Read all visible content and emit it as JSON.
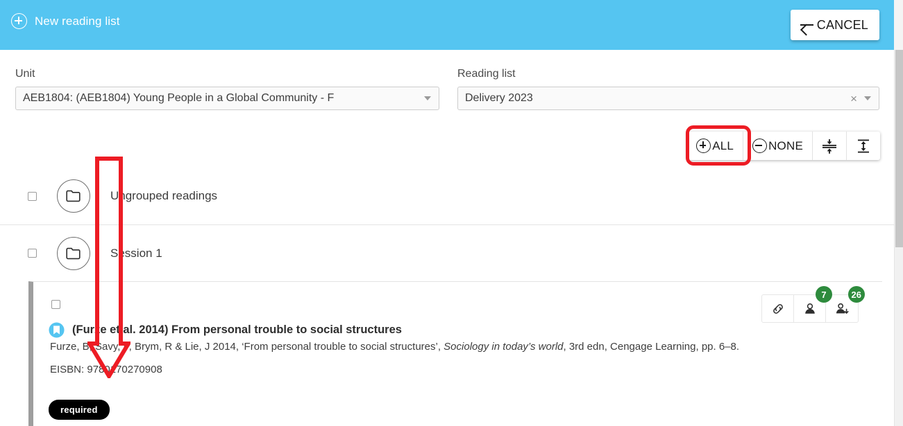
{
  "header": {
    "title": "New reading list",
    "add_icon": "plus-circle-icon",
    "cancel_label": "CANCEL",
    "back_icon": "arrow-left-icon",
    "background_color": "#55c5f1"
  },
  "form": {
    "unit": {
      "label": "Unit",
      "value": "AEB1804: (AEB1804) Young People in a Global Community - F",
      "caret_icon": "caret-down-icon"
    },
    "reading_list": {
      "label": "Reading list",
      "value": "Delivery 2023",
      "clear_icon": "×",
      "caret_icon": "caret-down-icon"
    }
  },
  "toolbar": {
    "all_label": "ALL",
    "none_label": "NONE",
    "all_icon": "plus-circle-icon",
    "none_icon": "minus-circle-icon",
    "collapse_icon": "collapse-all-icon",
    "expand_icon": "expand-all-icon"
  },
  "annotations": {
    "highlight_color": "#ed1c24",
    "rect_target": "ALL",
    "arrow_target": "reading-tree"
  },
  "folders": [
    {
      "name": "Ungrouped readings",
      "icon": "folder-icon",
      "checked": false
    },
    {
      "name": "Session 1",
      "icon": "folder-icon",
      "checked": false
    }
  ],
  "citation": {
    "checked": false,
    "type_icon": "book-icon",
    "title": "(Furze et al. 2014) From personal trouble to social structures",
    "reference_prefix": "Furze, B, Savy, P, Brym, R & Lie, J 2014, ‘From personal trouble to social structures’, ",
    "reference_italic": "Sociology in today’s world",
    "reference_suffix": ", 3rd edn, Cengage Learning, pp. 6–8.",
    "eisbn": "EISBN: 9780170270908",
    "required_badge": "required",
    "actions": [
      {
        "name": "link-icon",
        "badge": null
      },
      {
        "name": "person-icon",
        "badge": "7"
      },
      {
        "name": "person-download-icon",
        "badge": "26"
      }
    ],
    "badge_color": "#2e8b3d"
  },
  "scrollbar": {
    "orientation": "vertical",
    "position": "top"
  }
}
